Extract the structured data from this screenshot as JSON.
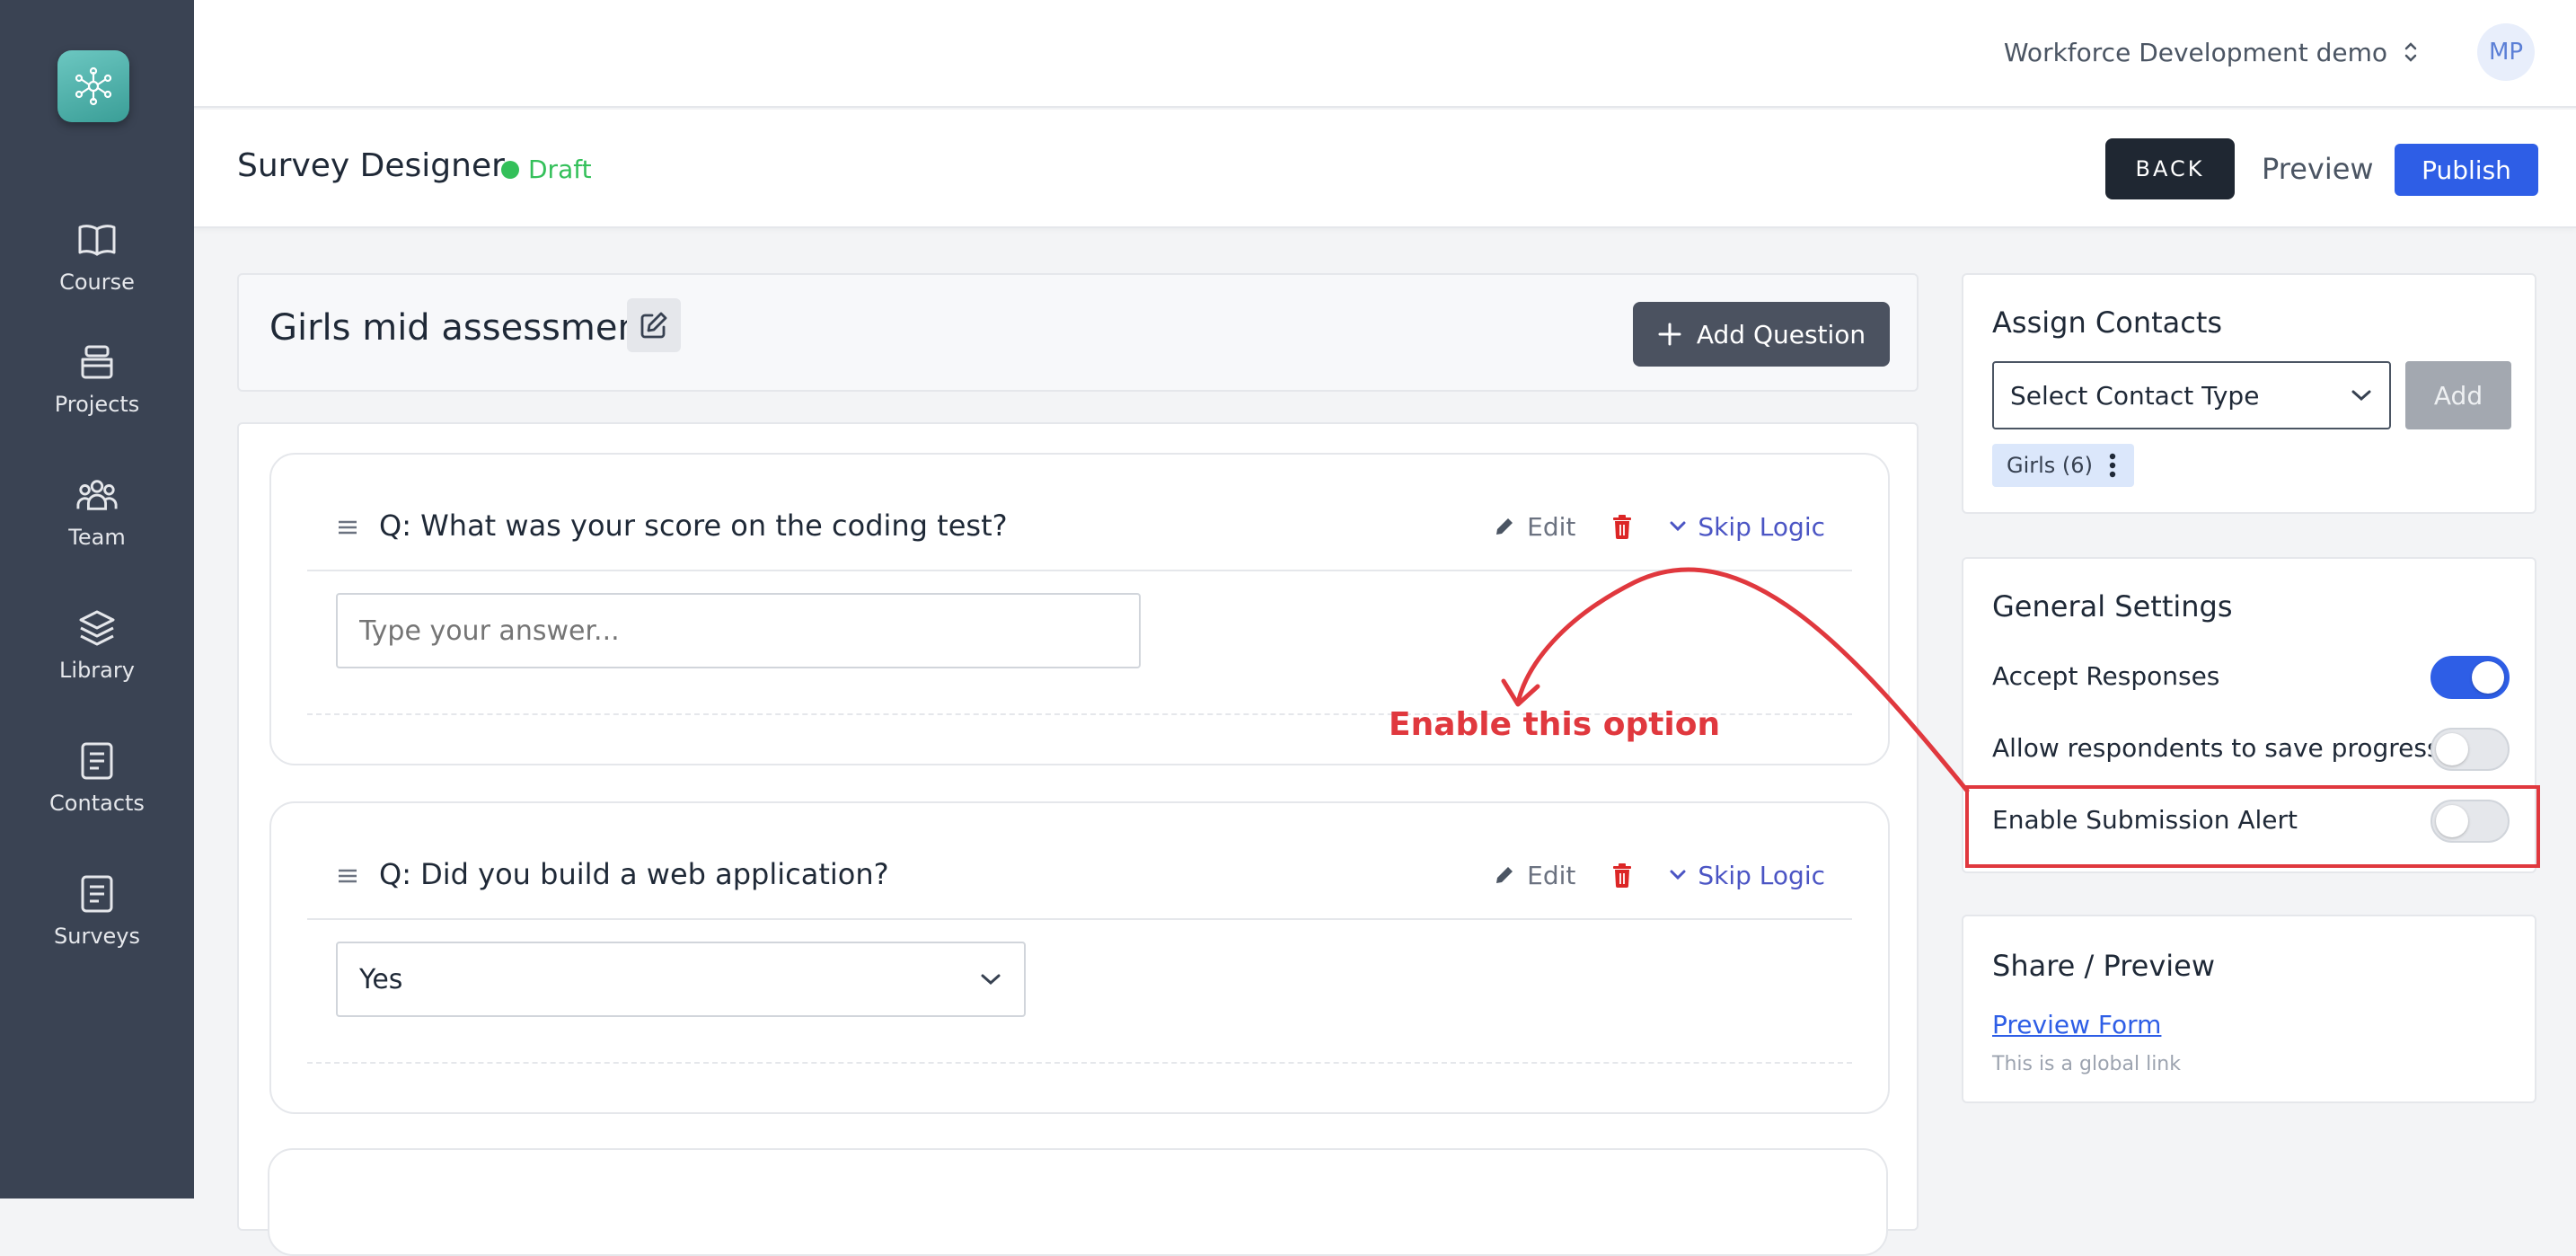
{
  "sidebar": {
    "items": [
      {
        "label": "Course",
        "icon": "book-icon"
      },
      {
        "label": "Projects",
        "icon": "stack-icon"
      },
      {
        "label": "Team",
        "icon": "team-icon"
      },
      {
        "label": "Library",
        "icon": "layers-icon"
      },
      {
        "label": "Contacts",
        "icon": "document-icon"
      },
      {
        "label": "Surveys",
        "icon": "document-icon"
      }
    ]
  },
  "topbar": {
    "org_name": "Workforce Development demo",
    "avatar_initials": "MP"
  },
  "header": {
    "title": "Survey Designer",
    "status": "Draft",
    "back_label": "BACK",
    "preview_label": "Preview",
    "publish_label": "Publish"
  },
  "survey": {
    "name": "Girls mid assessment",
    "add_question_label": "Add Question",
    "questions": [
      {
        "text": "Q: What was your score on the coding test?",
        "edit_label": "Edit",
        "skip_logic_label": "Skip Logic",
        "input_placeholder": "Type your answer..."
      },
      {
        "text": "Q: Did you build a web application?",
        "edit_label": "Edit",
        "skip_logic_label": "Skip Logic",
        "selected_value": "Yes"
      }
    ]
  },
  "annotation": {
    "text": "Enable this option",
    "color": "#e0383e"
  },
  "assign_contacts": {
    "title": "Assign Contacts",
    "select_value": "Select Contact Type",
    "add_label": "Add",
    "chips": [
      "Girls (6)"
    ]
  },
  "general_settings": {
    "title": "General Settings",
    "settings": [
      {
        "label": "Accept Responses",
        "enabled": true
      },
      {
        "label": "Allow respondents to save progress",
        "enabled": false
      },
      {
        "label": "Enable Submission Alert",
        "enabled": false
      }
    ]
  },
  "share": {
    "title": "Share / Preview",
    "link_label": "Preview Form",
    "note": "This is a global link"
  },
  "colors": {
    "sidebar_bg": "#3a4353",
    "primary": "#2e5ee6",
    "draft_green": "#34c05a",
    "danger": "#e0383e",
    "skip_logic": "#4b55c4"
  }
}
